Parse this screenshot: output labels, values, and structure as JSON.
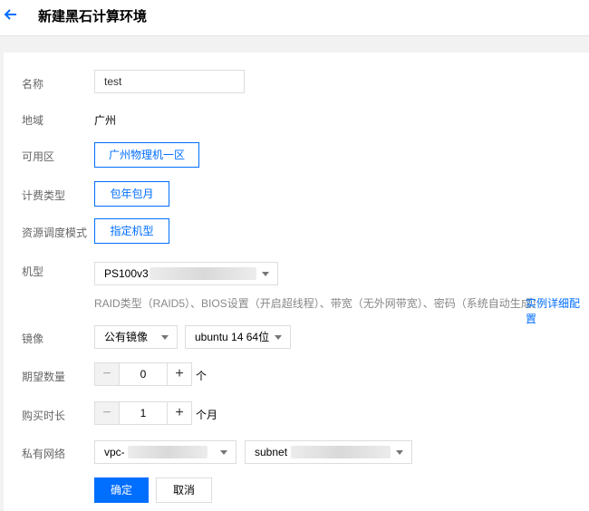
{
  "header": {
    "title": "新建黑石计算环境",
    "back_icon": "arrow-left-icon"
  },
  "form": {
    "name": {
      "label": "名称",
      "value": "test"
    },
    "region": {
      "label": "地域",
      "value": "广州"
    },
    "zone": {
      "label": "可用区",
      "value": "广州物理机一区"
    },
    "billing": {
      "label": "计费类型",
      "value": "包年包月"
    },
    "scheduling": {
      "label": "资源调度模式",
      "value": "指定机型"
    },
    "model": {
      "label": "机型",
      "value": "PS100v3",
      "hint": "RAID类型（RAID5）、BIOS设置（开启超线程）、带宽（无外网带宽）、密码（系统自动生成）",
      "link": "实例详细配置"
    },
    "image": {
      "label": "镜像",
      "type": "公有镜像",
      "os": "ubuntu 14 64位"
    },
    "expected_count": {
      "label": "期望数量",
      "value": "0",
      "unit": "个"
    },
    "duration": {
      "label": "购买时长",
      "value": "1",
      "unit": "个月"
    },
    "network": {
      "label": "私有网络",
      "vpc": "vpc-",
      "subnet": "subnet"
    }
  },
  "actions": {
    "confirm": "确定",
    "cancel": "取消"
  },
  "colors": {
    "accent": "#006eff",
    "background": "#f2f2f2"
  }
}
